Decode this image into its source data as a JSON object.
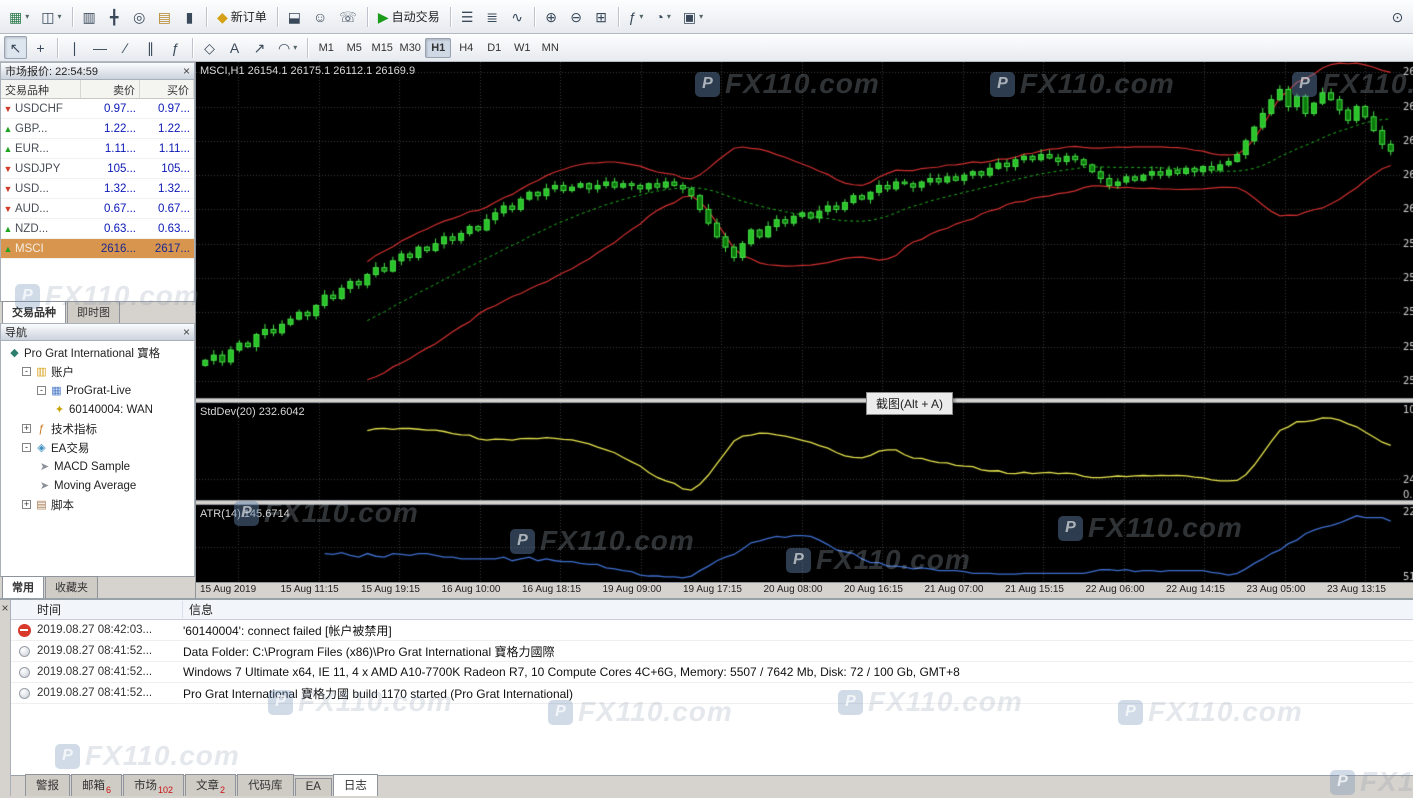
{
  "ui": {
    "window_note": "MetaTrader-style terminal"
  },
  "toolbar1": {
    "items": [
      {
        "name": "new-chart",
        "icon": "new-chart",
        "dropdown": true
      },
      {
        "name": "profiles",
        "icon": "profiles",
        "dropdown": true
      },
      {
        "type": "sep"
      },
      {
        "name": "market-watch",
        "icon": "market-watch"
      },
      {
        "name": "data-window",
        "icon": "data-window"
      },
      {
        "name": "navigator",
        "icon": "navigator"
      },
      {
        "name": "terminal",
        "icon": "terminal"
      },
      {
        "name": "strategy-tester",
        "icon": "strategy-tester"
      },
      {
        "type": "sep"
      },
      {
        "name": "new-order",
        "icon": "new-order",
        "label": "新订单"
      },
      {
        "type": "sep"
      },
      {
        "name": "metaeditor",
        "icon": "metaeditor"
      },
      {
        "name": "experts",
        "icon": "experts"
      },
      {
        "name": "support",
        "icon": "phone"
      },
      {
        "type": "sep"
      },
      {
        "name": "autotrading",
        "icon": "autotrading",
        "label": "自动交易"
      },
      {
        "type": "sep"
      },
      {
        "name": "chart-bars",
        "icon": "bars"
      },
      {
        "name": "chart-candles",
        "icon": "candles"
      },
      {
        "name": "chart-line",
        "icon": "linechart"
      },
      {
        "type": "sep"
      },
      {
        "name": "zoom-in",
        "icon": "zoom-in"
      },
      {
        "name": "zoom-out",
        "icon": "zoom-out"
      },
      {
        "name": "tile-windows",
        "icon": "grid"
      },
      {
        "type": "sep"
      },
      {
        "name": "indicators",
        "icon": "indicators",
        "dropdown": true
      },
      {
        "name": "periods",
        "icon": "clock",
        "dropdown": true
      },
      {
        "name": "templates",
        "icon": "templates",
        "dropdown": true
      },
      {
        "name": "search",
        "icon": "search",
        "right": true
      }
    ]
  },
  "toolbar2": {
    "tools": [
      {
        "name": "cursor",
        "icon": "cursor",
        "active": true
      },
      {
        "name": "crosshair",
        "icon": "crosshair"
      },
      {
        "type": "sep"
      },
      {
        "name": "vertical-line",
        "icon": "vline"
      },
      {
        "name": "horizontal-line",
        "icon": "hline"
      },
      {
        "name": "trendline",
        "icon": "trendline"
      },
      {
        "name": "channel",
        "icon": "channel"
      },
      {
        "name": "fibonacci",
        "icon": "fibonacci"
      },
      {
        "type": "sep"
      },
      {
        "name": "shapes",
        "icon": "shapes"
      },
      {
        "name": "text",
        "icon": "text"
      },
      {
        "name": "arrows",
        "icon": "arrows"
      },
      {
        "name": "cycles",
        "icon": "cycles",
        "dropdown": true
      },
      {
        "type": "sep"
      }
    ],
    "timeframes": [
      {
        "label": "M1"
      },
      {
        "label": "M5"
      },
      {
        "label": "M15"
      },
      {
        "label": "M30"
      },
      {
        "label": "H1",
        "active": true
      },
      {
        "label": "H4"
      },
      {
        "label": "D1"
      },
      {
        "label": "W1"
      },
      {
        "label": "MN"
      }
    ]
  },
  "market_watch": {
    "title": "市场报价: 22:54:59",
    "columns": [
      "交易品种",
      "卖价",
      "买价"
    ],
    "rows": [
      {
        "symbol": "USDCHF",
        "bid": "0.97...",
        "ask": "0.97...",
        "dir": "down"
      },
      {
        "symbol": "GBP...",
        "bid": "1.22...",
        "ask": "1.22...",
        "dir": "up"
      },
      {
        "symbol": "EUR...",
        "bid": "1.11...",
        "ask": "1.11...",
        "dir": "up"
      },
      {
        "symbol": "USDJPY",
        "bid": "105...",
        "ask": "105...",
        "dir": "down"
      },
      {
        "symbol": "USD...",
        "bid": "1.32...",
        "ask": "1.32...",
        "dir": "down"
      },
      {
        "symbol": "AUD...",
        "bid": "0.67...",
        "ask": "0.67...",
        "dir": "down"
      },
      {
        "symbol": "NZD...",
        "bid": "0.63...",
        "ask": "0.63...",
        "dir": "up"
      },
      {
        "symbol": "MSCI",
        "bid": "2616...",
        "ask": "2617...",
        "dir": "up",
        "selected": true
      }
    ],
    "tabs": [
      {
        "label": "交易品种",
        "active": true
      },
      {
        "label": "即时图"
      }
    ]
  },
  "navigator": {
    "title": "导航",
    "tree": [
      {
        "indent": 0,
        "icon": "root",
        "label": "Pro Grat International 寶格"
      },
      {
        "indent": 1,
        "expand": "-",
        "icon": "folder",
        "label": "账户"
      },
      {
        "indent": 2,
        "expand": "-",
        "icon": "server",
        "label": "ProGrat-Live"
      },
      {
        "indent": 3,
        "icon": "key",
        "label": "60140004: WAN"
      },
      {
        "indent": 1,
        "expand": "+",
        "icon": "indicator",
        "label": "技术指标"
      },
      {
        "indent": 1,
        "expand": "-",
        "icon": "ea",
        "label": "EA交易"
      },
      {
        "indent": 2,
        "icon": "advisor",
        "label": "MACD Sample"
      },
      {
        "indent": 2,
        "icon": "advisor",
        "label": "Moving Average"
      },
      {
        "indent": 1,
        "expand": "+",
        "icon": "script",
        "label": "脚本"
      }
    ],
    "tabs": [
      {
        "label": "常用",
        "active": true
      },
      {
        "label": "收藏夹"
      }
    ]
  },
  "chart": {
    "tooltip": "截图(Alt + A)"
  },
  "chart_data": {
    "type": "candlestick",
    "symbol": "MSCI",
    "timeframe": "H1",
    "ohlc_label": "MSCI,H1  26154.1 26175.1 26112.1 26169.9",
    "open": 26154.1,
    "high": 26175.1,
    "low": 26112.1,
    "close": 26169.9,
    "ylim": [
      25450,
      26430
    ],
    "ytick": 100,
    "closes": [
      25560,
      25575,
      25555,
      25590,
      25610,
      25600,
      25635,
      25650,
      25640,
      25665,
      25680,
      25700,
      25690,
      25720,
      25750,
      25740,
      25770,
      25790,
      25780,
      25810,
      25830,
      25820,
      25850,
      25870,
      25860,
      25890,
      25880,
      25900,
      25920,
      25910,
      25930,
      25950,
      25940,
      25970,
      25990,
      26010,
      26000,
      26030,
      26050,
      26040,
      26060,
      26070,
      26055,
      26065,
      26075,
      26060,
      26070,
      26080,
      26065,
      26075,
      26070,
      26060,
      26075,
      26065,
      26080,
      26070,
      26060,
      26040,
      26000,
      25960,
      25920,
      25890,
      25860,
      25900,
      25940,
      25920,
      25950,
      25970,
      25960,
      25980,
      25990,
      25975,
      25995,
      26010,
      26000,
      26020,
      26040,
      26030,
      26050,
      26070,
      26060,
      26080,
      26075,
      26065,
      26080,
      26090,
      26080,
      26095,
      26085,
      26100,
      26110,
      26100,
      26120,
      26135,
      26125,
      26145,
      26155,
      26145,
      26160,
      26150,
      26140,
      26155,
      26145,
      26130,
      26110,
      26090,
      26070,
      26080,
      26095,
      26085,
      26100,
      26110,
      26100,
      26115,
      26105,
      26120,
      26110,
      26125,
      26115,
      26130,
      26140,
      26160,
      26200,
      26240,
      26280,
      26320,
      26350,
      26300,
      26330,
      26280,
      26310,
      26340,
      26320,
      26290,
      26260,
      26300,
      26270,
      26230,
      26190,
      26170
    ],
    "x_labels": [
      "15 Aug 2019",
      "15 Aug 11:15",
      "15 Aug 19:15",
      "16 Aug 10:00",
      "16 Aug 18:15",
      "19 Aug 09:00",
      "19 Aug 17:15",
      "20 Aug 08:00",
      "20 Aug 16:15",
      "21 Aug 07:00",
      "21 Aug 15:15",
      "22 Aug 06:00",
      "22 Aug 14:15",
      "23 Aug 05:00",
      "23 Aug 13:15"
    ],
    "indicators": [
      {
        "name": "StdDev",
        "window": 20,
        "value": "232.6042",
        "label": "StdDev(20) 232.6042",
        "color": "#e8e64e"
      },
      {
        "name": "ATR",
        "window": 14,
        "value": "145.6714",
        "label": "ATR(14) 145.6714",
        "color": "#3f6fd0"
      }
    ],
    "colors": {
      "background": "#000000",
      "grid": "#3a3a3a",
      "candle_up": "#29c329",
      "candle_down": "#0b7a0b",
      "candle_border": "#45e045",
      "bands": "#d23030",
      "ma": "#1fae1f",
      "axis_text": "#d0d0d0"
    }
  },
  "terminal": {
    "columns": [
      "时间",
      "信息"
    ],
    "rows": [
      {
        "icon": "error",
        "time": "2019.08.27 08:42:03...",
        "message": "'60140004': connect failed [帐户被禁用]"
      },
      {
        "icon": "info",
        "time": "2019.08.27 08:41:52...",
        "message": "Data Folder: C:\\Program Files (x86)\\Pro Grat International 寶格力國際"
      },
      {
        "icon": "info",
        "time": "2019.08.27 08:41:52...",
        "message": "Windows 7 Ultimate x64, IE 11, 4 x AMD A10-7700K Radeon R7, 10 Compute Cores 4C+6G, Memory: 5507 / 7642 Mb, Disk: 72 / 100 Gb, GMT+8"
      },
      {
        "icon": "info",
        "time": "2019.08.27 08:41:52...",
        "message": "Pro Grat International 寶格力國 build 1170 started (Pro Grat International)"
      }
    ],
    "tabs": [
      {
        "label": "警报"
      },
      {
        "label": "邮箱",
        "badge": "6"
      },
      {
        "label": "市场",
        "badge": "102"
      },
      {
        "label": "文章",
        "badge": "2"
      },
      {
        "label": "代码库"
      },
      {
        "label": "EA"
      },
      {
        "label": "日志",
        "active": true
      }
    ]
  },
  "watermark": {
    "text": "FX110",
    "suffix": ".com",
    "logo": "P"
  }
}
